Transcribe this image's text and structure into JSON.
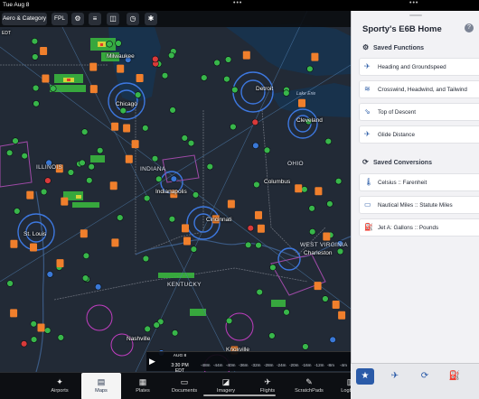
{
  "status_bar": {
    "time": "Tue Aug 8",
    "handle_dots": "•••",
    "panel_dots": "•••"
  },
  "toolbar": {
    "layer_label": "Aero & Category",
    "fpl_label": "FPL",
    "icons": [
      "gear-icon",
      "settings-sliders-icon",
      "layers-icon",
      "timer-icon",
      "location-icon"
    ]
  },
  "map": {
    "edge_label": "EDT",
    "cities": [
      "Milwaukee",
      "Chicago",
      "Detroit",
      "Cleveland",
      "Indianapolis",
      "Cincinnati",
      "Columbus",
      "Charleston",
      "St. Louis",
      "Nashville",
      "Knoxville"
    ],
    "states": [
      "ILLINOIS",
      "INDIANA",
      "OHIO",
      "KENTUCKY",
      "WEST VIRGINIA"
    ],
    "water": [
      "Lake Erie"
    ]
  },
  "timebar": {
    "date": "AUG 8",
    "clock": "3:30 PM EDT",
    "offsets": [
      "-48m",
      "-44m",
      "-40m",
      "-36m",
      "-32m",
      "-28m",
      "-24m",
      "-20m",
      "-16m",
      "-12m",
      "-8m",
      "-4m"
    ]
  },
  "panel": {
    "title": "Sporty's E6B Home",
    "saved_functions": {
      "heading": "Saved Functions",
      "items": [
        {
          "label": "Heading and Groundspeed",
          "icon": "plane-heading-icon"
        },
        {
          "label": "Crosswind, Headwind, and Tailwind",
          "icon": "wind-icon"
        },
        {
          "label": "Top of Descent",
          "icon": "descent-icon"
        },
        {
          "label": "Glide Distance",
          "icon": "glide-icon"
        }
      ]
    },
    "saved_conversions": {
      "heading": "Saved Conversions",
      "items": [
        {
          "label": "Celsius :: Farenheit",
          "icon": "thermometer-icon"
        },
        {
          "label": "Nautical Miles :: Statute Miles",
          "icon": "ruler-icon"
        },
        {
          "label": "Jet A: Gallons :: Pounds",
          "icon": "fuel-icon"
        }
      ]
    }
  },
  "tabs": [
    {
      "label": "Airports",
      "icon": "airport-icon"
    },
    {
      "label": "Maps",
      "icon": "map-icon",
      "active": true
    },
    {
      "label": "Plates",
      "icon": "plates-icon"
    },
    {
      "label": "Documents",
      "icon": "documents-icon"
    },
    {
      "label": "Imagery",
      "icon": "imagery-icon"
    },
    {
      "label": "Flights",
      "icon": "flights-icon"
    },
    {
      "label": "ScratchPads",
      "icon": "scratchpad-icon"
    },
    {
      "label": "Logbook",
      "icon": "logbook-icon"
    }
  ],
  "colors": {
    "accent": "#2a5aa8",
    "vfr": "#38b64a",
    "mvfr": "#3a78d6",
    "ifr": "#d93a3a",
    "tfr": "#f07f2c"
  }
}
